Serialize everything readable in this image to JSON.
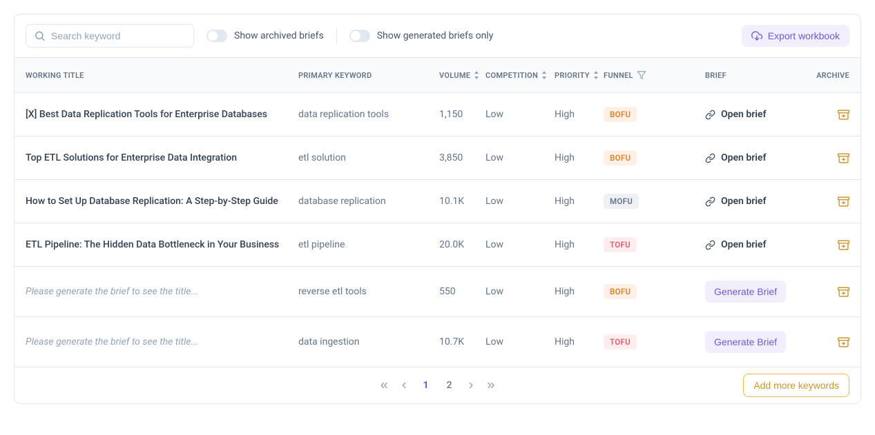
{
  "toolbar": {
    "search_placeholder": "Search keyword",
    "toggle_archived_label": "Show archived briefs",
    "toggle_generated_label": "Show generated briefs only",
    "export_label": "Export workbook"
  },
  "columns": {
    "working_title": "WORKING TITLE",
    "primary_keyword": "PRIMARY KEYWORD",
    "volume": "VOLUME",
    "competition": "COMPETITION",
    "priority": "PRIORITY",
    "funnel": "FUNNEL",
    "brief": "BRIEF",
    "archive": "ARCHIVE"
  },
  "labels": {
    "open_brief": "Open brief",
    "generate_brief": "Generate Brief",
    "placeholder_title": "Please generate the brief to see the title..."
  },
  "rows": [
    {
      "title": "[X] Best Data Replication Tools for Enterprise Databases",
      "keyword": "data replication tools",
      "volume": "1,150",
      "competition": "Low",
      "priority": "High",
      "funnel": "BOFU",
      "has_brief": true
    },
    {
      "title": "Top ETL Solutions for Enterprise Data Integration",
      "keyword": "etl solution",
      "volume": "3,850",
      "competition": "Low",
      "priority": "High",
      "funnel": "BOFU",
      "has_brief": true
    },
    {
      "title": "How to Set Up Database Replication: A Step-by-Step Guide",
      "keyword": "database replication",
      "volume": "10.1K",
      "competition": "Low",
      "priority": "High",
      "funnel": "MOFU",
      "has_brief": true
    },
    {
      "title": "ETL Pipeline: The Hidden Data Bottleneck in Your Business",
      "keyword": "etl pipeline",
      "volume": "20.0K",
      "competition": "Low",
      "priority": "High",
      "funnel": "TOFU",
      "has_brief": true
    },
    {
      "title": null,
      "keyword": "reverse etl tools",
      "volume": "550",
      "competition": "Low",
      "priority": "High",
      "funnel": "BOFU",
      "has_brief": false
    },
    {
      "title": null,
      "keyword": "data ingestion",
      "volume": "10.7K",
      "competition": "Low",
      "priority": "High",
      "funnel": "TOFU",
      "has_brief": false
    }
  ],
  "pagination": {
    "pages": [
      "1",
      "2"
    ],
    "current": "1"
  },
  "footer": {
    "add_more_label": "Add more keywords"
  }
}
